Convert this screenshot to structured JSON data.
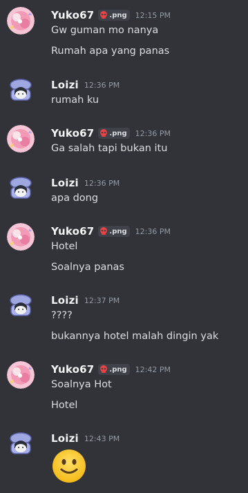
{
  "messages": [
    {
      "user": "Yuko67",
      "tag": ".png",
      "time": "12:15 PM",
      "lines": [
        "Gw guman mo nanya",
        "Rumah apa yang panas"
      ]
    },
    {
      "user": "Loizi",
      "time": "12:36 PM",
      "lines": [
        "rumah ku"
      ]
    },
    {
      "user": "Yuko67",
      "tag": ".png",
      "time": "12:36 PM",
      "lines": [
        "Ga salah tapi bukan itu"
      ]
    },
    {
      "user": "Loizi",
      "time": "12:36 PM",
      "lines": [
        "apa dong"
      ]
    },
    {
      "user": "Yuko67",
      "tag": ".png",
      "time": "12:36 PM",
      "lines": [
        "Hotel",
        "Soalnya panas"
      ]
    },
    {
      "user": "Loizi",
      "time": "12:37 PM",
      "lines": [
        "????",
        "bukannya hotel malah dingin yak"
      ]
    },
    {
      "user": "Yuko67",
      "tag": ".png",
      "time": "12:42 PM",
      "lines": [
        "Soalnya Hot",
        "Hotel"
      ]
    },
    {
      "user": "Loizi",
      "time": "12:43 PM",
      "emoji": "slightly-smiling-face"
    }
  ],
  "colors": {
    "background": "#313338",
    "username": "#f2f3f5",
    "text": "#dbdee1",
    "timestamp": "#949ba4",
    "tag_bg": "#3f4248",
    "skull": "#ed4245"
  },
  "icons": {
    "yuko_avatar": "anime-avatar-pink",
    "loizi_avatar": "anime-avatar-basket",
    "tag_icon": "skull-icon"
  }
}
